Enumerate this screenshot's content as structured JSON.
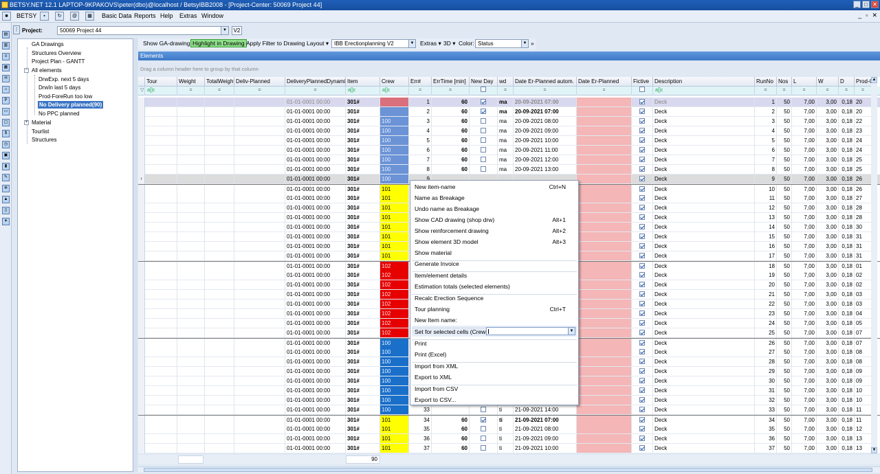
{
  "window": {
    "title": "BETSY.NET 12.1  LAPTOP-9KPAKOVS\\peter(dbo)@localhost / BetsyIBB2008 - [Project-Center: 50069 Project 44]",
    "min": "_",
    "max": "□",
    "close": "✕"
  },
  "menu": {
    "items": [
      "BETSY",
      "Basic Data",
      "Reports",
      "Help",
      "Extras",
      "Window"
    ],
    "mdi": [
      "_",
      "▫",
      "✕"
    ]
  },
  "project": {
    "label": "Project:",
    "value": "50069 Project 44",
    "version": "V2"
  },
  "tree": {
    "items": [
      "GA Drawings",
      "Structures Overview",
      "Project Plan - GANTT",
      "All elements",
      "DrwExp. next 5 days",
      "DrwIn last 5 days",
      "Prod-ForeRun too low",
      "No Delivery planned(90)",
      "No PPC planned",
      "Material",
      "Tourlist",
      "Structures"
    ]
  },
  "toolbar": {
    "show_ga": "Show GA-drawing",
    "highlight": "Highlight in Drawing",
    "apply_filter": "Apply Filter to Drawing",
    "layout": "Layout",
    "layout_value": "IBB Erectionplanning V2",
    "extras": "Extras",
    "view3d": "3D",
    "color_label": "Color:",
    "color_value": "Status"
  },
  "panel": {
    "title": "Elements",
    "group_hint": "Drag a column header here to group by that column"
  },
  "columns": [
    "Tour",
    "Weight",
    "TotalWeight",
    "Deliv-Planned",
    "DeliveryPlannedDynamic",
    "Item",
    "Crew",
    "Err#",
    "ErrTime [min]",
    "New Day",
    "wd",
    "Date Er-Planned autom.",
    "Date Er-Planned",
    "Fictive",
    "Description",
    "RunNo",
    "Nos",
    "L",
    "W",
    "D",
    "Prod-C"
  ],
  "filter_row": {
    "text_filter": "a[]c",
    "eq_filter": "="
  },
  "rows": [
    {
      "no": 1,
      "delivery": "01-01-0001 00:00",
      "item": "301#",
      "crew": "",
      "crew_color": "#d9707c",
      "errtime": 60,
      "newday": true,
      "wd": "ma",
      "date": "20-09-2021 07:00",
      "date_bold": true,
      "desc": "Deck",
      "runno": 1,
      "nos": 50,
      "l": "7,00",
      "w": "3,00",
      "d": "0,18",
      "prod": "20"
    },
    {
      "no": 2,
      "delivery": "01-01-0001 00:00",
      "item": "301#",
      "crew": "",
      "crew_color": "#6b93d6",
      "errtime": 60,
      "newday": true,
      "wd": "ma",
      "date": "20-09-2021 07:00",
      "date_bold": true,
      "desc": "Deck",
      "runno": 2,
      "nos": 50,
      "l": "7,00",
      "w": "3,00",
      "d": "0,18",
      "prod": "20"
    },
    {
      "no": 3,
      "delivery": "01-01-0001 00:00",
      "item": "301#",
      "crew": "100",
      "crew_color": "#6b93d6",
      "errtime": 60,
      "newday": false,
      "wd": "ma",
      "date": "20-09-2021 08:00",
      "date_bold": false,
      "desc": "Deck",
      "runno": 3,
      "nos": 50,
      "l": "7,00",
      "w": "3,00",
      "d": "0,18",
      "prod": "22"
    },
    {
      "no": 4,
      "delivery": "01-01-0001 00:00",
      "item": "301#",
      "crew": "100",
      "crew_color": "#6b93d6",
      "errtime": 60,
      "newday": false,
      "wd": "ma",
      "date": "20-09-2021 09:00",
      "date_bold": false,
      "desc": "Deck",
      "runno": 4,
      "nos": 50,
      "l": "7,00",
      "w": "3,00",
      "d": "0,18",
      "prod": "23"
    },
    {
      "no": 5,
      "delivery": "01-01-0001 00:00",
      "item": "301#",
      "crew": "100",
      "crew_color": "#6b93d6",
      "errtime": 60,
      "newday": false,
      "wd": "ma",
      "date": "20-09-2021 10:00",
      "date_bold": false,
      "desc": "Deck",
      "runno": 5,
      "nos": 50,
      "l": "7,00",
      "w": "3,00",
      "d": "0,18",
      "prod": "24"
    },
    {
      "no": 6,
      "delivery": "01-01-0001 00:00",
      "item": "301#",
      "crew": "100",
      "crew_color": "#6b93d6",
      "errtime": 60,
      "newday": false,
      "wd": "ma",
      "date": "20-09-2021 11:00",
      "date_bold": false,
      "desc": "Deck",
      "runno": 6,
      "nos": 50,
      "l": "7,00",
      "w": "3,00",
      "d": "0,18",
      "prod": "24"
    },
    {
      "no": 7,
      "delivery": "01-01-0001 00:00",
      "item": "301#",
      "crew": "100",
      "crew_color": "#6b93d6",
      "errtime": 60,
      "newday": false,
      "wd": "ma",
      "date": "20-09-2021 12:00",
      "date_bold": false,
      "desc": "Deck",
      "runno": 7,
      "nos": 50,
      "l": "7,00",
      "w": "3,00",
      "d": "0,18",
      "prod": "25"
    },
    {
      "no": 8,
      "delivery": "01-01-0001 00:00",
      "item": "301#",
      "crew": "100",
      "crew_color": "#6b93d6",
      "errtime": 60,
      "newday": false,
      "wd": "ma",
      "date": "20-09-2021 13:00",
      "date_bold": false,
      "desc": "Deck",
      "runno": 8,
      "nos": 50,
      "l": "7,00",
      "w": "3,00",
      "d": "0,18",
      "prod": "25"
    },
    {
      "no": 9,
      "delivery": "01-01-0001 00:00",
      "item": "301#",
      "crew": "100",
      "crew_color": "#6b93d6",
      "errtime": null,
      "newday": false,
      "wd": "",
      "date": "",
      "date_bold": false,
      "desc": "Deck",
      "runno": 9,
      "nos": 50,
      "l": "7,00",
      "w": "3,00",
      "d": "0,18",
      "prod": "26"
    },
    {
      "no": 10,
      "delivery": "01-01-0001 00:00",
      "item": "301#",
      "crew": "101",
      "crew_color": "#ffff00",
      "errtime": null,
      "newday": false,
      "wd": "",
      "date": "",
      "date_bold": false,
      "desc": "Deck",
      "runno": 10,
      "nos": 50,
      "l": "7,00",
      "w": "3,00",
      "d": "0,18",
      "prod": "26"
    },
    {
      "no": 11,
      "delivery": "01-01-0001 00:00",
      "item": "301#",
      "crew": "101",
      "crew_color": "#ffff00",
      "errtime": null,
      "newday": false,
      "wd": "",
      "date": "",
      "date_bold": false,
      "desc": "Deck",
      "runno": 11,
      "nos": 50,
      "l": "7,00",
      "w": "3,00",
      "d": "0,18",
      "prod": "27"
    },
    {
      "no": 12,
      "delivery": "01-01-0001 00:00",
      "item": "301#",
      "crew": "101",
      "crew_color": "#ffff00",
      "errtime": null,
      "newday": false,
      "wd": "",
      "date": "",
      "date_bold": false,
      "desc": "Deck",
      "runno": 12,
      "nos": 50,
      "l": "7,00",
      "w": "3,00",
      "d": "0,18",
      "prod": "28"
    },
    {
      "no": 13,
      "delivery": "01-01-0001 00:00",
      "item": "301#",
      "crew": "101",
      "crew_color": "#ffff00",
      "errtime": null,
      "newday": false,
      "wd": "",
      "date": "",
      "date_bold": false,
      "desc": "Deck",
      "runno": 13,
      "nos": 50,
      "l": "7,00",
      "w": "3,00",
      "d": "0,18",
      "prod": "28"
    },
    {
      "no": 14,
      "delivery": "01-01-0001 00:00",
      "item": "301#",
      "crew": "101",
      "crew_color": "#ffff00",
      "errtime": null,
      "newday": false,
      "wd": "",
      "date": "",
      "date_bold": false,
      "desc": "Deck",
      "runno": 14,
      "nos": 50,
      "l": "7,00",
      "w": "3,00",
      "d": "0,18",
      "prod": "30"
    },
    {
      "no": 15,
      "delivery": "01-01-0001 00:00",
      "item": "301#",
      "crew": "101",
      "crew_color": "#ffff00",
      "errtime": null,
      "newday": false,
      "wd": "",
      "date": "",
      "date_bold": false,
      "desc": "Deck",
      "runno": 15,
      "nos": 50,
      "l": "7,00",
      "w": "3,00",
      "d": "0,18",
      "prod": "31"
    },
    {
      "no": 16,
      "delivery": "01-01-0001 00:00",
      "item": "301#",
      "crew": "101",
      "crew_color": "#ffff00",
      "errtime": null,
      "newday": false,
      "wd": "",
      "date": "",
      "date_bold": false,
      "desc": "Deck",
      "runno": 16,
      "nos": 50,
      "l": "7,00",
      "w": "3,00",
      "d": "0,18",
      "prod": "31"
    },
    {
      "no": 17,
      "delivery": "01-01-0001 00:00",
      "item": "301#",
      "crew": "101",
      "crew_color": "#ffff00",
      "errtime": null,
      "newday": false,
      "wd": "",
      "date": "",
      "date_bold": false,
      "desc": "Deck",
      "runno": 17,
      "nos": 50,
      "l": "7,00",
      "w": "3,00",
      "d": "0,18",
      "prod": "31"
    },
    {
      "no": 18,
      "delivery": "01-01-0001 00:00",
      "item": "301#",
      "crew": "102",
      "crew_color": "#e60000",
      "errtime": null,
      "newday": false,
      "wd": "",
      "date": "",
      "date_bold": false,
      "desc": "Deck",
      "runno": 18,
      "nos": 50,
      "l": "7,00",
      "w": "3,00",
      "d": "0,18",
      "prod": "01"
    },
    {
      "no": 19,
      "delivery": "01-01-0001 00:00",
      "item": "301#",
      "crew": "102",
      "crew_color": "#e60000",
      "errtime": null,
      "newday": false,
      "wd": "",
      "date": "",
      "date_bold": false,
      "desc": "Deck",
      "runno": 19,
      "nos": 50,
      "l": "7,00",
      "w": "3,00",
      "d": "0,18",
      "prod": "02"
    },
    {
      "no": 20,
      "delivery": "01-01-0001 00:00",
      "item": "301#",
      "crew": "102",
      "crew_color": "#e60000",
      "errtime": null,
      "newday": false,
      "wd": "",
      "date": "",
      "date_bold": false,
      "desc": "Deck",
      "runno": 20,
      "nos": 50,
      "l": "7,00",
      "w": "3,00",
      "d": "0,18",
      "prod": "02"
    },
    {
      "no": 21,
      "delivery": "01-01-0001 00:00",
      "item": "301#",
      "crew": "102",
      "crew_color": "#e60000",
      "errtime": null,
      "newday": false,
      "wd": "",
      "date": "",
      "date_bold": false,
      "desc": "Deck",
      "runno": 21,
      "nos": 50,
      "l": "7,00",
      "w": "3,00",
      "d": "0,18",
      "prod": "03"
    },
    {
      "no": 22,
      "delivery": "01-01-0001 00:00",
      "item": "301#",
      "crew": "102",
      "crew_color": "#e60000",
      "errtime": null,
      "newday": false,
      "wd": "",
      "date": "",
      "date_bold": false,
      "desc": "Deck",
      "runno": 22,
      "nos": 50,
      "l": "7,00",
      "w": "3,00",
      "d": "0,18",
      "prod": "03"
    },
    {
      "no": 23,
      "delivery": "01-01-0001 00:00",
      "item": "301#",
      "crew": "102",
      "crew_color": "#e60000",
      "errtime": null,
      "newday": false,
      "wd": "",
      "date": "",
      "date_bold": false,
      "desc": "Deck",
      "runno": 23,
      "nos": 50,
      "l": "7,00",
      "w": "3,00",
      "d": "0,18",
      "prod": "04"
    },
    {
      "no": 24,
      "delivery": "01-01-0001 00:00",
      "item": "301#",
      "crew": "102",
      "crew_color": "#e60000",
      "errtime": null,
      "newday": false,
      "wd": "",
      "date": "",
      "date_bold": false,
      "desc": "Deck",
      "runno": 24,
      "nos": 50,
      "l": "7,00",
      "w": "3,00",
      "d": "0,18",
      "prod": "05"
    },
    {
      "no": 25,
      "delivery": "01-01-0001 00:00",
      "item": "301#",
      "crew": "102",
      "crew_color": "#e60000",
      "errtime": null,
      "newday": false,
      "wd": "",
      "date": "",
      "date_bold": false,
      "desc": "Deck",
      "runno": 25,
      "nos": 50,
      "l": "7,00",
      "w": "3,00",
      "d": "0,18",
      "prod": "07"
    },
    {
      "no": 26,
      "delivery": "01-01-0001 00:00",
      "item": "301#",
      "crew": "100",
      "crew_color": "#1a6fc9",
      "errtime": null,
      "newday": false,
      "wd": "",
      "date": "",
      "date_bold": false,
      "desc": "Deck",
      "runno": 26,
      "nos": 50,
      "l": "7,00",
      "w": "3,00",
      "d": "0,18",
      "prod": "07"
    },
    {
      "no": 27,
      "delivery": "01-01-0001 00:00",
      "item": "301#",
      "crew": "100",
      "crew_color": "#1a6fc9",
      "errtime": null,
      "newday": false,
      "wd": "",
      "date": "",
      "date_bold": false,
      "desc": "Deck",
      "runno": 27,
      "nos": 50,
      "l": "7,00",
      "w": "3,00",
      "d": "0,18",
      "prod": "08"
    },
    {
      "no": 28,
      "delivery": "01-01-0001 00:00",
      "item": "301#",
      "crew": "100",
      "crew_color": "#1a6fc9",
      "errtime": null,
      "newday": false,
      "wd": "",
      "date": "",
      "date_bold": false,
      "desc": "Deck",
      "runno": 28,
      "nos": 50,
      "l": "7,00",
      "w": "3,00",
      "d": "0,18",
      "prod": "08"
    },
    {
      "no": 29,
      "delivery": "01-01-0001 00:00",
      "item": "301#",
      "crew": "100",
      "crew_color": "#1a6fc9",
      "errtime": null,
      "newday": false,
      "wd": "",
      "date": "",
      "date_bold": false,
      "desc": "Deck",
      "runno": 29,
      "nos": 50,
      "l": "7,00",
      "w": "3,00",
      "d": "0,18",
      "prod": "09"
    },
    {
      "no": 30,
      "delivery": "01-01-0001 00:00",
      "item": "301#",
      "crew": "100",
      "crew_color": "#1a6fc9",
      "errtime": null,
      "newday": false,
      "wd": "",
      "date": "",
      "date_bold": false,
      "desc": "Deck",
      "runno": 30,
      "nos": 50,
      "l": "7,00",
      "w": "3,00",
      "d": "0,18",
      "prod": "09"
    },
    {
      "no": 31,
      "delivery": "01-01-0001 00:00",
      "item": "301#",
      "crew": "100",
      "crew_color": "#1a6fc9",
      "errtime": null,
      "newday": false,
      "wd": "",
      "date": "",
      "date_bold": false,
      "desc": "Deck",
      "runno": 31,
      "nos": 50,
      "l": "7,00",
      "w": "3,00",
      "d": "0,18",
      "prod": "10"
    },
    {
      "no": 32,
      "delivery": "01-01-0001 00:00",
      "item": "301#",
      "crew": "100",
      "crew_color": "#1a6fc9",
      "errtime": null,
      "newday": false,
      "wd": "",
      "date": "",
      "date_bold": false,
      "desc": "Deck",
      "runno": 32,
      "nos": 50,
      "l": "7,00",
      "w": "3,00",
      "d": "0,18",
      "prod": "10"
    },
    {
      "no": 33,
      "delivery": "01-01-0001 00:00",
      "item": "301#",
      "crew": "100",
      "crew_color": "#1a6fc9",
      "errtime": null,
      "newday": false,
      "wd": "ti",
      "date": "21-09-2021 14:00",
      "date_bold": false,
      "desc": "Deck",
      "runno": 33,
      "nos": 50,
      "l": "7,00",
      "w": "3,00",
      "d": "0,18",
      "prod": "11"
    },
    {
      "no": 34,
      "delivery": "01-01-0001 00:00",
      "item": "301#",
      "crew": "101",
      "crew_color": "#ffff00",
      "errtime": 60,
      "newday": true,
      "wd": "ti",
      "date": "21-09-2021 07:00",
      "date_bold": true,
      "desc": "Deck",
      "runno": 34,
      "nos": 50,
      "l": "7,00",
      "w": "3,00",
      "d": "0,18",
      "prod": "11"
    },
    {
      "no": 35,
      "delivery": "01-01-0001 00:00",
      "item": "301#",
      "crew": "101",
      "crew_color": "#ffff00",
      "errtime": 60,
      "newday": false,
      "wd": "ti",
      "date": "21-09-2021 08:00",
      "date_bold": false,
      "desc": "Deck",
      "runno": 35,
      "nos": 50,
      "l": "7,00",
      "w": "3,00",
      "d": "0,18",
      "prod": "12"
    },
    {
      "no": 36,
      "delivery": "01-01-0001 00:00",
      "item": "301#",
      "crew": "101",
      "crew_color": "#ffff00",
      "errtime": 60,
      "newday": false,
      "wd": "ti",
      "date": "21-09-2021 09:00",
      "date_bold": false,
      "desc": "Deck",
      "runno": 36,
      "nos": 50,
      "l": "7,00",
      "w": "3,00",
      "d": "0,18",
      "prod": "13"
    },
    {
      "no": 37,
      "delivery": "01-01-0001 00:00",
      "item": "301#",
      "crew": "101",
      "crew_color": "#ffff00",
      "errtime": 60,
      "newday": false,
      "wd": "ti",
      "date": "21-09-2021 10:00",
      "date_bold": false,
      "desc": "Deck",
      "runno": 37,
      "nos": 50,
      "l": "7,00",
      "w": "3,00",
      "d": "0,18",
      "prod": "13"
    }
  ],
  "summary": {
    "count": "90"
  },
  "context_menu": {
    "items": [
      {
        "label": "New item-name",
        "shortcut": "Ctrl+N"
      },
      {
        "label": "Name as Breakage",
        "shortcut": ""
      },
      {
        "label": "Undo name as Breakage",
        "shortcut": ""
      },
      {
        "label": "Show CAD drawing (shop drw)",
        "shortcut": "Alt+1"
      },
      {
        "label": "Show reinforcement drawing",
        "shortcut": "Alt+2"
      },
      {
        "label": "Show element 3D model",
        "shortcut": "Alt+3"
      },
      {
        "label": "Show material",
        "shortcut": ""
      },
      {
        "label": "Generate Invoice",
        "shortcut": ""
      },
      {
        "label": "Item/element details",
        "shortcut": ""
      },
      {
        "label": "Estimation totals (selected elements)",
        "shortcut": ""
      },
      {
        "label": "Recalc Erection Sequence",
        "shortcut": ""
      },
      {
        "label": "Tour planning",
        "shortcut": "Ctrl+T"
      },
      {
        "label": "New Item name:",
        "shortcut": ""
      },
      {
        "label": "Set for selected cells (Crew):",
        "shortcut": ""
      },
      {
        "label": "Print",
        "shortcut": ""
      },
      {
        "label": "Print (Excel)",
        "shortcut": ""
      },
      {
        "label": "Import from XML",
        "shortcut": ""
      },
      {
        "label": "Export to XML",
        "shortcut": ""
      },
      {
        "label": "Import from CSV",
        "shortcut": ""
      },
      {
        "label": "Export to CSV...",
        "shortcut": ""
      }
    ],
    "crew_input_value": ""
  },
  "colors": {
    "date_planned_bg": "#f4b6b6",
    "selected_row": "#d8d8ee",
    "current_row": "#dcdcdc"
  }
}
